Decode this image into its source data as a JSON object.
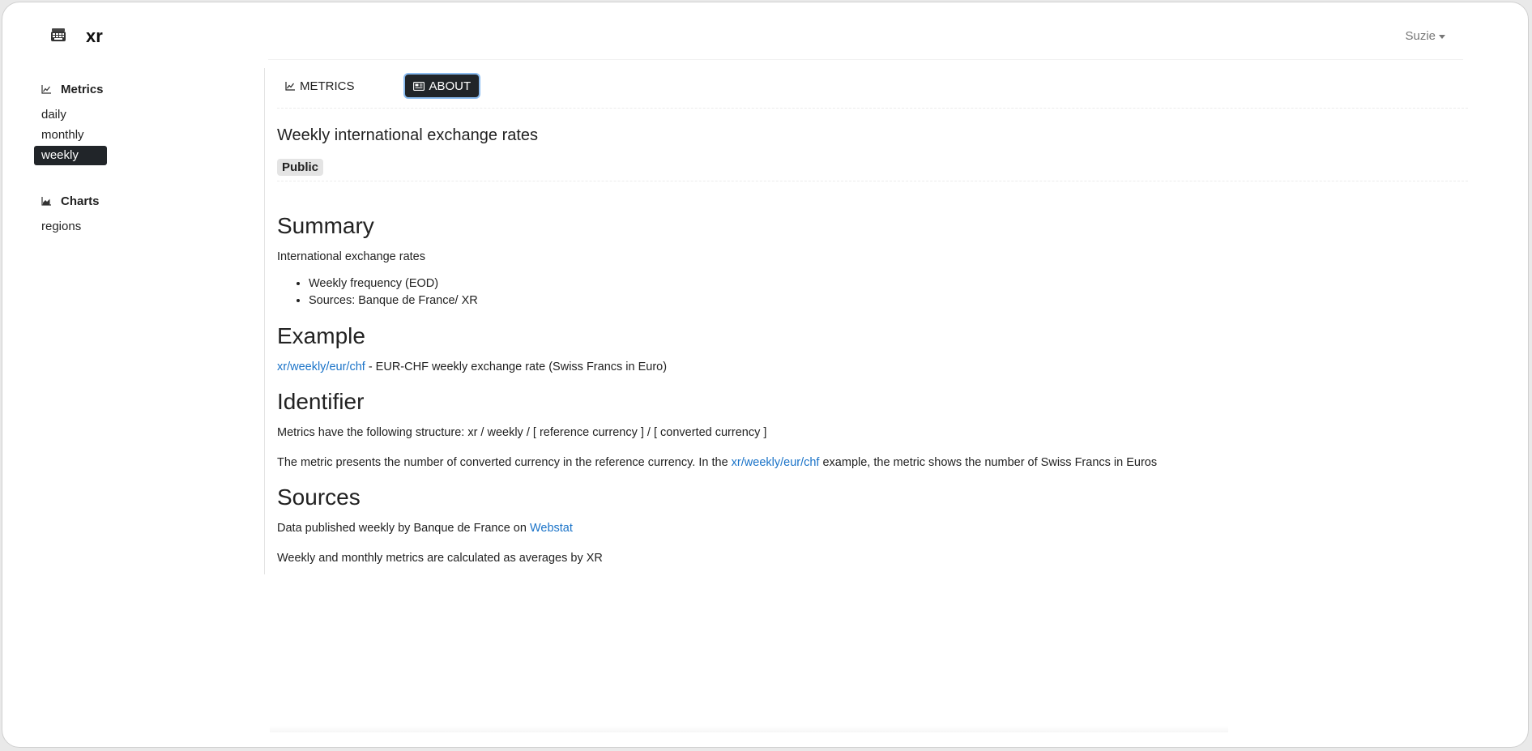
{
  "app": {
    "title": "xr",
    "user": "Suzie"
  },
  "sidebar": {
    "metrics_heading": "Metrics",
    "metrics": [
      "daily",
      "monthly",
      "weekly"
    ],
    "charts_heading": "Charts",
    "charts": [
      "regions"
    ]
  },
  "tabs": {
    "metrics": "METRICS",
    "about": "ABOUT"
  },
  "page": {
    "title": "Weekly international exchange rates",
    "badge": "Public"
  },
  "doc": {
    "summary_heading": "Summary",
    "summary_text": "International exchange rates",
    "bullets": [
      "Weekly frequency (EOD)",
      "Sources: Banque de France/ XR"
    ],
    "example_heading": "Example",
    "example_link": "xr/weekly/eur/chf",
    "example_rest": " - EUR-CHF weekly exchange rate (Swiss Francs in Euro)",
    "identifier_heading": "Identifier",
    "identifier_text": "Metrics have the following structure: xr / weekly / [ reference currency ] / [ converted currency ]",
    "metric_text_1": "The metric presents the number of converted currency in the reference currency. In the ",
    "metric_link": "xr/weekly/eur/chf",
    "metric_text_2": " example, the metric shows the number of Swiss Francs in Euros",
    "sources_heading": "Sources",
    "sources_text": "Data published weekly by Banque de France on ",
    "sources_link": "Webstat",
    "averages_text": "Weekly and monthly metrics are calculated as averages by XR"
  }
}
